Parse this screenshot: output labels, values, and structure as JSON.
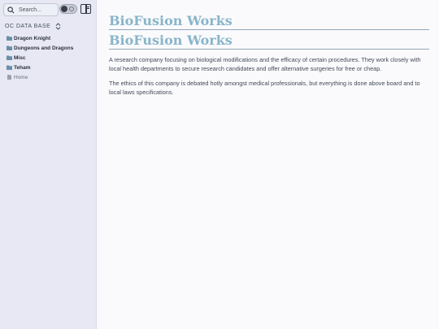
{
  "sidebar": {
    "search_placeholder": "Search...",
    "vault_title": "OC DATA BASE",
    "items": [
      {
        "label": "Dragon Knight",
        "icon": "folder-icon"
      },
      {
        "label": "Dungeons and Dragons",
        "icon": "folder-icon"
      },
      {
        "label": "Misc",
        "icon": "folder-icon"
      },
      {
        "label": "Teham",
        "icon": "folder-icon"
      },
      {
        "label": "Home",
        "icon": "file-icon"
      }
    ]
  },
  "note": {
    "title": "BioFusion Works",
    "heading": "BioFusion Works",
    "paragraphs": [
      "A research company focusing on biological modifications and the efficacy of certain procedures. They work closely with local health departments to secure research candidates and offer alternative surgeries for free or cheap.",
      "The ethics of this company is debated hotly amongst medical professionals, but everything is done above board and to local laws specifications."
    ]
  },
  "colors": {
    "sidebar_bg": "#e7e8f3",
    "heading": "#88b5c9",
    "folder": "#6a8fa8"
  }
}
